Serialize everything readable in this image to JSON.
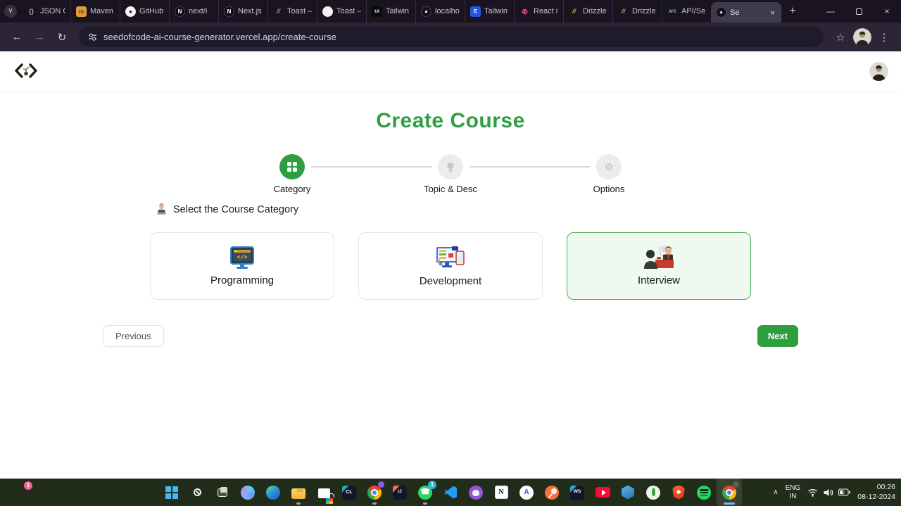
{
  "browser": {
    "url": "seedofcode-ai-course-generator.vercel.app/create-course",
    "glyphs": {
      "tab_search": "∨",
      "new_tab": "+",
      "minimize": "—",
      "close_window": "×",
      "tab_close": "×",
      "back": "←",
      "forward": "→",
      "reload": "↻",
      "star": "☆",
      "menu": "⋮",
      "tray_chevron": "∧"
    },
    "tabs": [
      {
        "title": "JSON C",
        "icon": "json",
        "glyph": "{}"
      },
      {
        "title": "Maven",
        "icon": "maven",
        "glyph": "m"
      },
      {
        "title": "GitHub",
        "icon": "github",
        "glyph": "●"
      },
      {
        "title": "next/i",
        "icon": "nextjs",
        "glyph": "N"
      },
      {
        "title": "Next.js",
        "icon": "nextjs",
        "glyph": "N"
      },
      {
        "title": "Toast –",
        "icon": "slash",
        "glyph": "//"
      },
      {
        "title": "Toast –",
        "icon": "toast",
        "glyph": ""
      },
      {
        "title": "Tailwin",
        "icon": "ui",
        "glyph": "UI"
      },
      {
        "title": "localho",
        "icon": "vercel",
        "glyph": "▲"
      },
      {
        "title": "Tailwin",
        "icon": "te",
        "glyph": "E"
      },
      {
        "title": "React i",
        "icon": "react",
        "glyph": "⊛"
      },
      {
        "title": "Drizzle",
        "icon": "drizzle",
        "glyph": "//"
      },
      {
        "title": "Drizzle",
        "icon": "drizzle",
        "glyph": "//"
      },
      {
        "title": "API/Se",
        "icon": "api",
        "glyph": "API"
      },
      {
        "title": "Se",
        "icon": "vercel-active",
        "glyph": "▲",
        "active": true
      }
    ]
  },
  "page": {
    "title": "Create Course",
    "steps": [
      {
        "label": "Category",
        "active": true
      },
      {
        "label": "Topic & Desc",
        "active": false
      },
      {
        "label": "Options",
        "active": false,
        "glyph": "⚙"
      }
    ],
    "select_label": "Select the Course Category",
    "select_emoji": "🧑‍💻",
    "cards": [
      {
        "label": "Programming",
        "selected": false
      },
      {
        "label": "Development",
        "selected": false
      },
      {
        "label": "Interview",
        "selected": true
      }
    ],
    "buttons": {
      "previous": "Previous",
      "next": "Next"
    }
  },
  "taskbar": {
    "notification_badge": "1",
    "pinned": [
      {
        "name": "start"
      },
      {
        "name": "search"
      },
      {
        "name": "task-view",
        "cls": "taskview"
      },
      {
        "name": "copilot"
      },
      {
        "name": "edge"
      },
      {
        "name": "file-explorer",
        "cls": "explorer",
        "open": true
      },
      {
        "name": "microsoft-store",
        "cls": "store"
      },
      {
        "name": "clion",
        "glyph": "CL"
      },
      {
        "name": "chrome",
        "open": true,
        "dot": "#8a5cf5"
      },
      {
        "name": "intellij-idea",
        "cls": "ij",
        "glyph": "IJ"
      },
      {
        "name": "whatsapp",
        "open": true,
        "badge": "1",
        "badge_color": "#29b6d8",
        "glyph": "☎"
      },
      {
        "name": "vscode"
      },
      {
        "name": "github-desktop",
        "cls": "ghd"
      },
      {
        "name": "notion",
        "glyph": "N"
      },
      {
        "name": "apna-college",
        "cls": "apna",
        "glyph": "A"
      },
      {
        "name": "postman"
      },
      {
        "name": "webstorm",
        "glyph": "WS"
      },
      {
        "name": "youtube"
      },
      {
        "name": "hexagon-app",
        "cls": "hex"
      },
      {
        "name": "mongodb",
        "cls": "mongo"
      },
      {
        "name": "brave"
      },
      {
        "name": "spotify"
      },
      {
        "name": "chrome-active",
        "cls": "chrome",
        "active": true,
        "dot": "#5a5f58"
      }
    ],
    "tray": {
      "language": "ENG",
      "region": "IN",
      "time": "00:26",
      "date": "08-12-2024"
    }
  },
  "colors": {
    "accent_green": "#2f9e41",
    "title_green": "#2f9e44",
    "selected_card_bg": "#eefaf0",
    "selected_card_border": "#4bae54",
    "browser_bg": "#2b2537",
    "tabstrip_bg": "#191420",
    "taskbar_bg": "#222c1a"
  }
}
